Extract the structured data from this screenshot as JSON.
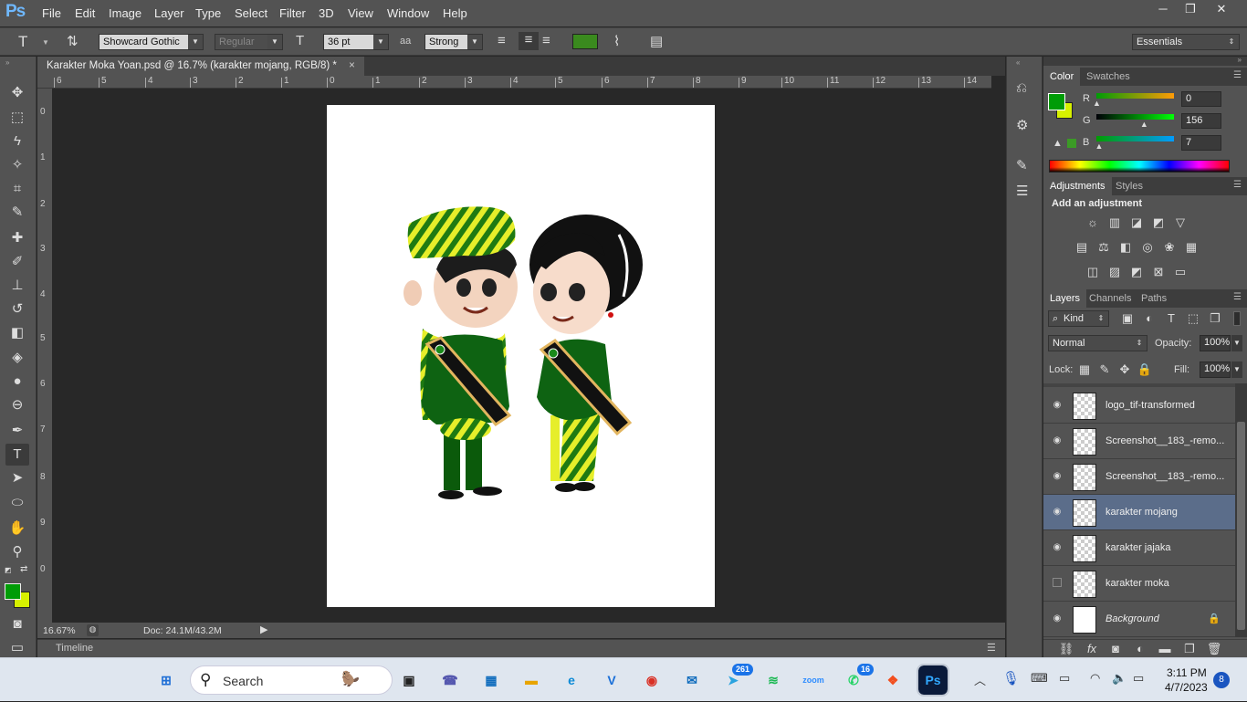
{
  "app": {
    "logo": "Ps",
    "menu": [
      "File",
      "Edit",
      "Image",
      "Layer",
      "Type",
      "Select",
      "Filter",
      "3D",
      "View",
      "Window",
      "Help"
    ],
    "win_min": "─",
    "win_max": "❐",
    "win_close": "✕"
  },
  "options": {
    "font_family": "Showcard Gothic",
    "font_style": "Regular",
    "font_size": "36 pt",
    "aa_label": "aa",
    "antialias": "Strong",
    "color_swatch": "#3a8a1e",
    "workspace": "Essentials"
  },
  "document": {
    "tab_title": "Karakter Moka Yoan.psd @ 16.7% (karakter mojang, RGB/8) *",
    "close": "×",
    "zoom": "16.67%",
    "doc_size": "Doc: 24.1M/43.2M"
  },
  "rulers": {
    "h": [
      "6",
      "5",
      "4",
      "3",
      "2",
      "1",
      "0",
      "1",
      "2",
      "3",
      "4",
      "5",
      "6",
      "7",
      "8",
      "9",
      "10",
      "11",
      "12",
      "13",
      "14"
    ],
    "v": [
      "0",
      "1",
      "2",
      "3",
      "4",
      "5",
      "6",
      "7",
      "8",
      "9",
      "0"
    ]
  },
  "timeline": {
    "label": "Timeline"
  },
  "color_panel": {
    "tabs": [
      "Color",
      "Swatches"
    ],
    "r_label": "R",
    "g_label": "G",
    "b_label": "B",
    "r": "0",
    "g": "156",
    "b": "7",
    "r_level": 0,
    "g_level": 0.61,
    "b_level": 0.03,
    "fg": "#009c07",
    "bg": "#d7f000"
  },
  "adjustments": {
    "tabs": [
      "Adjustments",
      "Styles"
    ],
    "heading": "Add an adjustment"
  },
  "layers_panel": {
    "tabs": [
      "Layers",
      "Channels",
      "Paths"
    ],
    "kind": "Kind",
    "blend": "Normal",
    "opacity_label": "Opacity:",
    "opacity": "100%",
    "lock_label": "Lock:",
    "fill_label": "Fill:",
    "fill": "100%",
    "layers": [
      {
        "name": "logo_tif-transformed",
        "visible": true,
        "selected": false
      },
      {
        "name": "Screenshot__183_-remo...",
        "visible": true,
        "selected": false
      },
      {
        "name": "Screenshot__183_-remo...",
        "visible": true,
        "selected": false
      },
      {
        "name": "karakter mojang",
        "visible": true,
        "selected": true
      },
      {
        "name": "karakter jajaka",
        "visible": true,
        "selected": false
      },
      {
        "name": "karakter moka",
        "visible": false,
        "selected": false
      },
      {
        "name": "Background",
        "visible": true,
        "selected": false,
        "locked": true
      }
    ],
    "footer_icons": [
      "link-icon",
      "fx-icon",
      "mask-icon",
      "adjustment-icon",
      "folder-icon",
      "new-layer-icon",
      "trash-icon"
    ]
  },
  "taskbar": {
    "search": "Search",
    "time": "3:11 PM",
    "date": "4/7/2023",
    "notif_count": "8",
    "telegram_badge": "261",
    "whatsapp_badge": "16",
    "apps": [
      {
        "name": "start",
        "glyph": "⊞",
        "color": "#1f6fd6"
      },
      {
        "name": "task-view",
        "glyph": "▣",
        "color": "#222"
      },
      {
        "name": "teams",
        "glyph": "☎",
        "color": "#5558af"
      },
      {
        "name": "store",
        "glyph": "▦",
        "color": "#0f6cbd"
      },
      {
        "name": "file-explorer",
        "glyph": "▬",
        "color": "#e8a400"
      },
      {
        "name": "edge",
        "glyph": "e",
        "color": "#0c8ad6"
      },
      {
        "name": "vpn",
        "glyph": "V",
        "color": "#1a6fd8"
      },
      {
        "name": "chrome",
        "glyph": "◉",
        "color": "#d93025"
      },
      {
        "name": "mail",
        "glyph": "✉",
        "color": "#0f6cbd"
      },
      {
        "name": "telegram",
        "glyph": "➤",
        "color": "#2aa3df"
      },
      {
        "name": "spotify",
        "glyph": "≋",
        "color": "#1db954"
      },
      {
        "name": "zoom",
        "glyph": "zoom",
        "color": "#2d8cff"
      },
      {
        "name": "whatsapp",
        "glyph": "✆",
        "color": "#25d366"
      },
      {
        "name": "figma",
        "glyph": "❖",
        "color": "#f24e1e"
      },
      {
        "name": "photoshop",
        "glyph": "Ps",
        "color": "#0a1a3a"
      }
    ]
  }
}
